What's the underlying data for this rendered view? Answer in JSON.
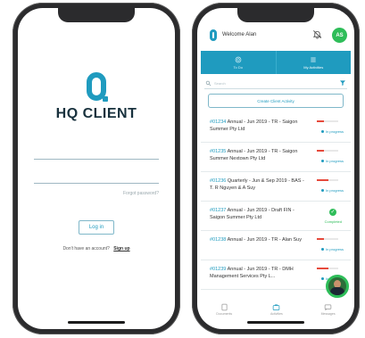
{
  "login": {
    "brand": "HQ CLIENT",
    "username_placeholder": "",
    "password_placeholder": "",
    "forgot_label": "Forgot password?",
    "login_button": "Log in",
    "signup_prompt": "Don't have an account?",
    "signup_link": "Sign up"
  },
  "app": {
    "welcome": "Welcome Alan",
    "avatar_initials": "AS",
    "tabs": [
      {
        "label": "To Do"
      },
      {
        "label": "My Activities"
      }
    ],
    "search_placeholder": "Search",
    "create_button": "Create Client Activity",
    "items": [
      {
        "code": "#01234",
        "text": "Annual - Jun 2019 - TR - Saigon Summer Pty Ltd",
        "progress": 0.35,
        "status": "In progress"
      },
      {
        "code": "#01235",
        "text": "Annual - Jun 2019 - TR - Saigon Summer Nextown Pty Ltd",
        "progress": 0.35,
        "status": "In progress"
      },
      {
        "code": "#01236",
        "text": "Quarterly - Jun & Sep 2019 - BAS - T. R Nguyen & A Suy",
        "progress": 0.55,
        "status": "In progress"
      },
      {
        "code": "#01237",
        "text": "Annual - Jun 2019 - Draft FIN - Saigon Summer Pty Ltd",
        "progress": 1.0,
        "status": "Completed",
        "done": true
      },
      {
        "code": "#01238",
        "text": "Annual - Jun 2019 - TR - Alan Suy",
        "progress": 0.35,
        "status": "In progress"
      },
      {
        "code": "#01239",
        "text": "Annual - Jun 2019 - TR - DMH Management Services Pty L...",
        "progress": 0.55,
        "status": "In progress"
      }
    ],
    "bottom_nav": [
      {
        "label": "Documents"
      },
      {
        "label": "Activities"
      },
      {
        "label": "Messages"
      }
    ]
  },
  "colors": {
    "accent": "#1f9bbf",
    "success": "#2ebd59",
    "danger": "#e64a3c"
  }
}
